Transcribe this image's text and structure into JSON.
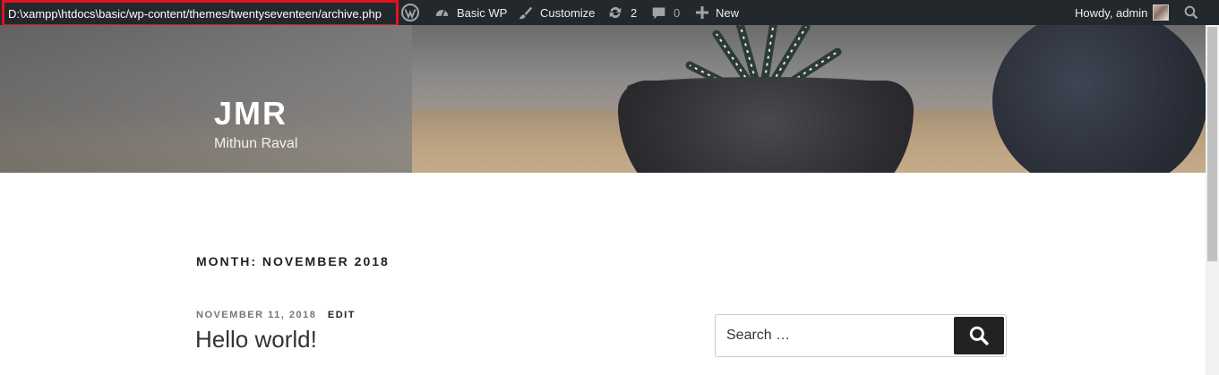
{
  "adminbar": {
    "file_path": "D:\\xampp\\htdocs\\basic/wp-content/themes/twentyseventeen/archive.php",
    "site_name": "Basic WP",
    "customize": "Customize",
    "updates_count": "2",
    "comments_count": "0",
    "new_label": "New",
    "greeting": "Howdy, admin"
  },
  "header": {
    "site_title": "JMR",
    "site_description": "Mithun Raval"
  },
  "archive": {
    "title": "MONTH: NOVEMBER 2018"
  },
  "post": {
    "date": "NOVEMBER 11, 2018",
    "edit_label": "EDIT",
    "title": "Hello world!"
  },
  "search": {
    "placeholder": "Search …"
  },
  "colors": {
    "adminbar_bg": "#23282d",
    "highlight_border": "#e0131d",
    "search_button": "#222222"
  },
  "icons": [
    "wordpress-icon",
    "dashboard-icon",
    "brush-icon",
    "updates-icon",
    "comment-icon",
    "plus-icon",
    "search-icon"
  ]
}
